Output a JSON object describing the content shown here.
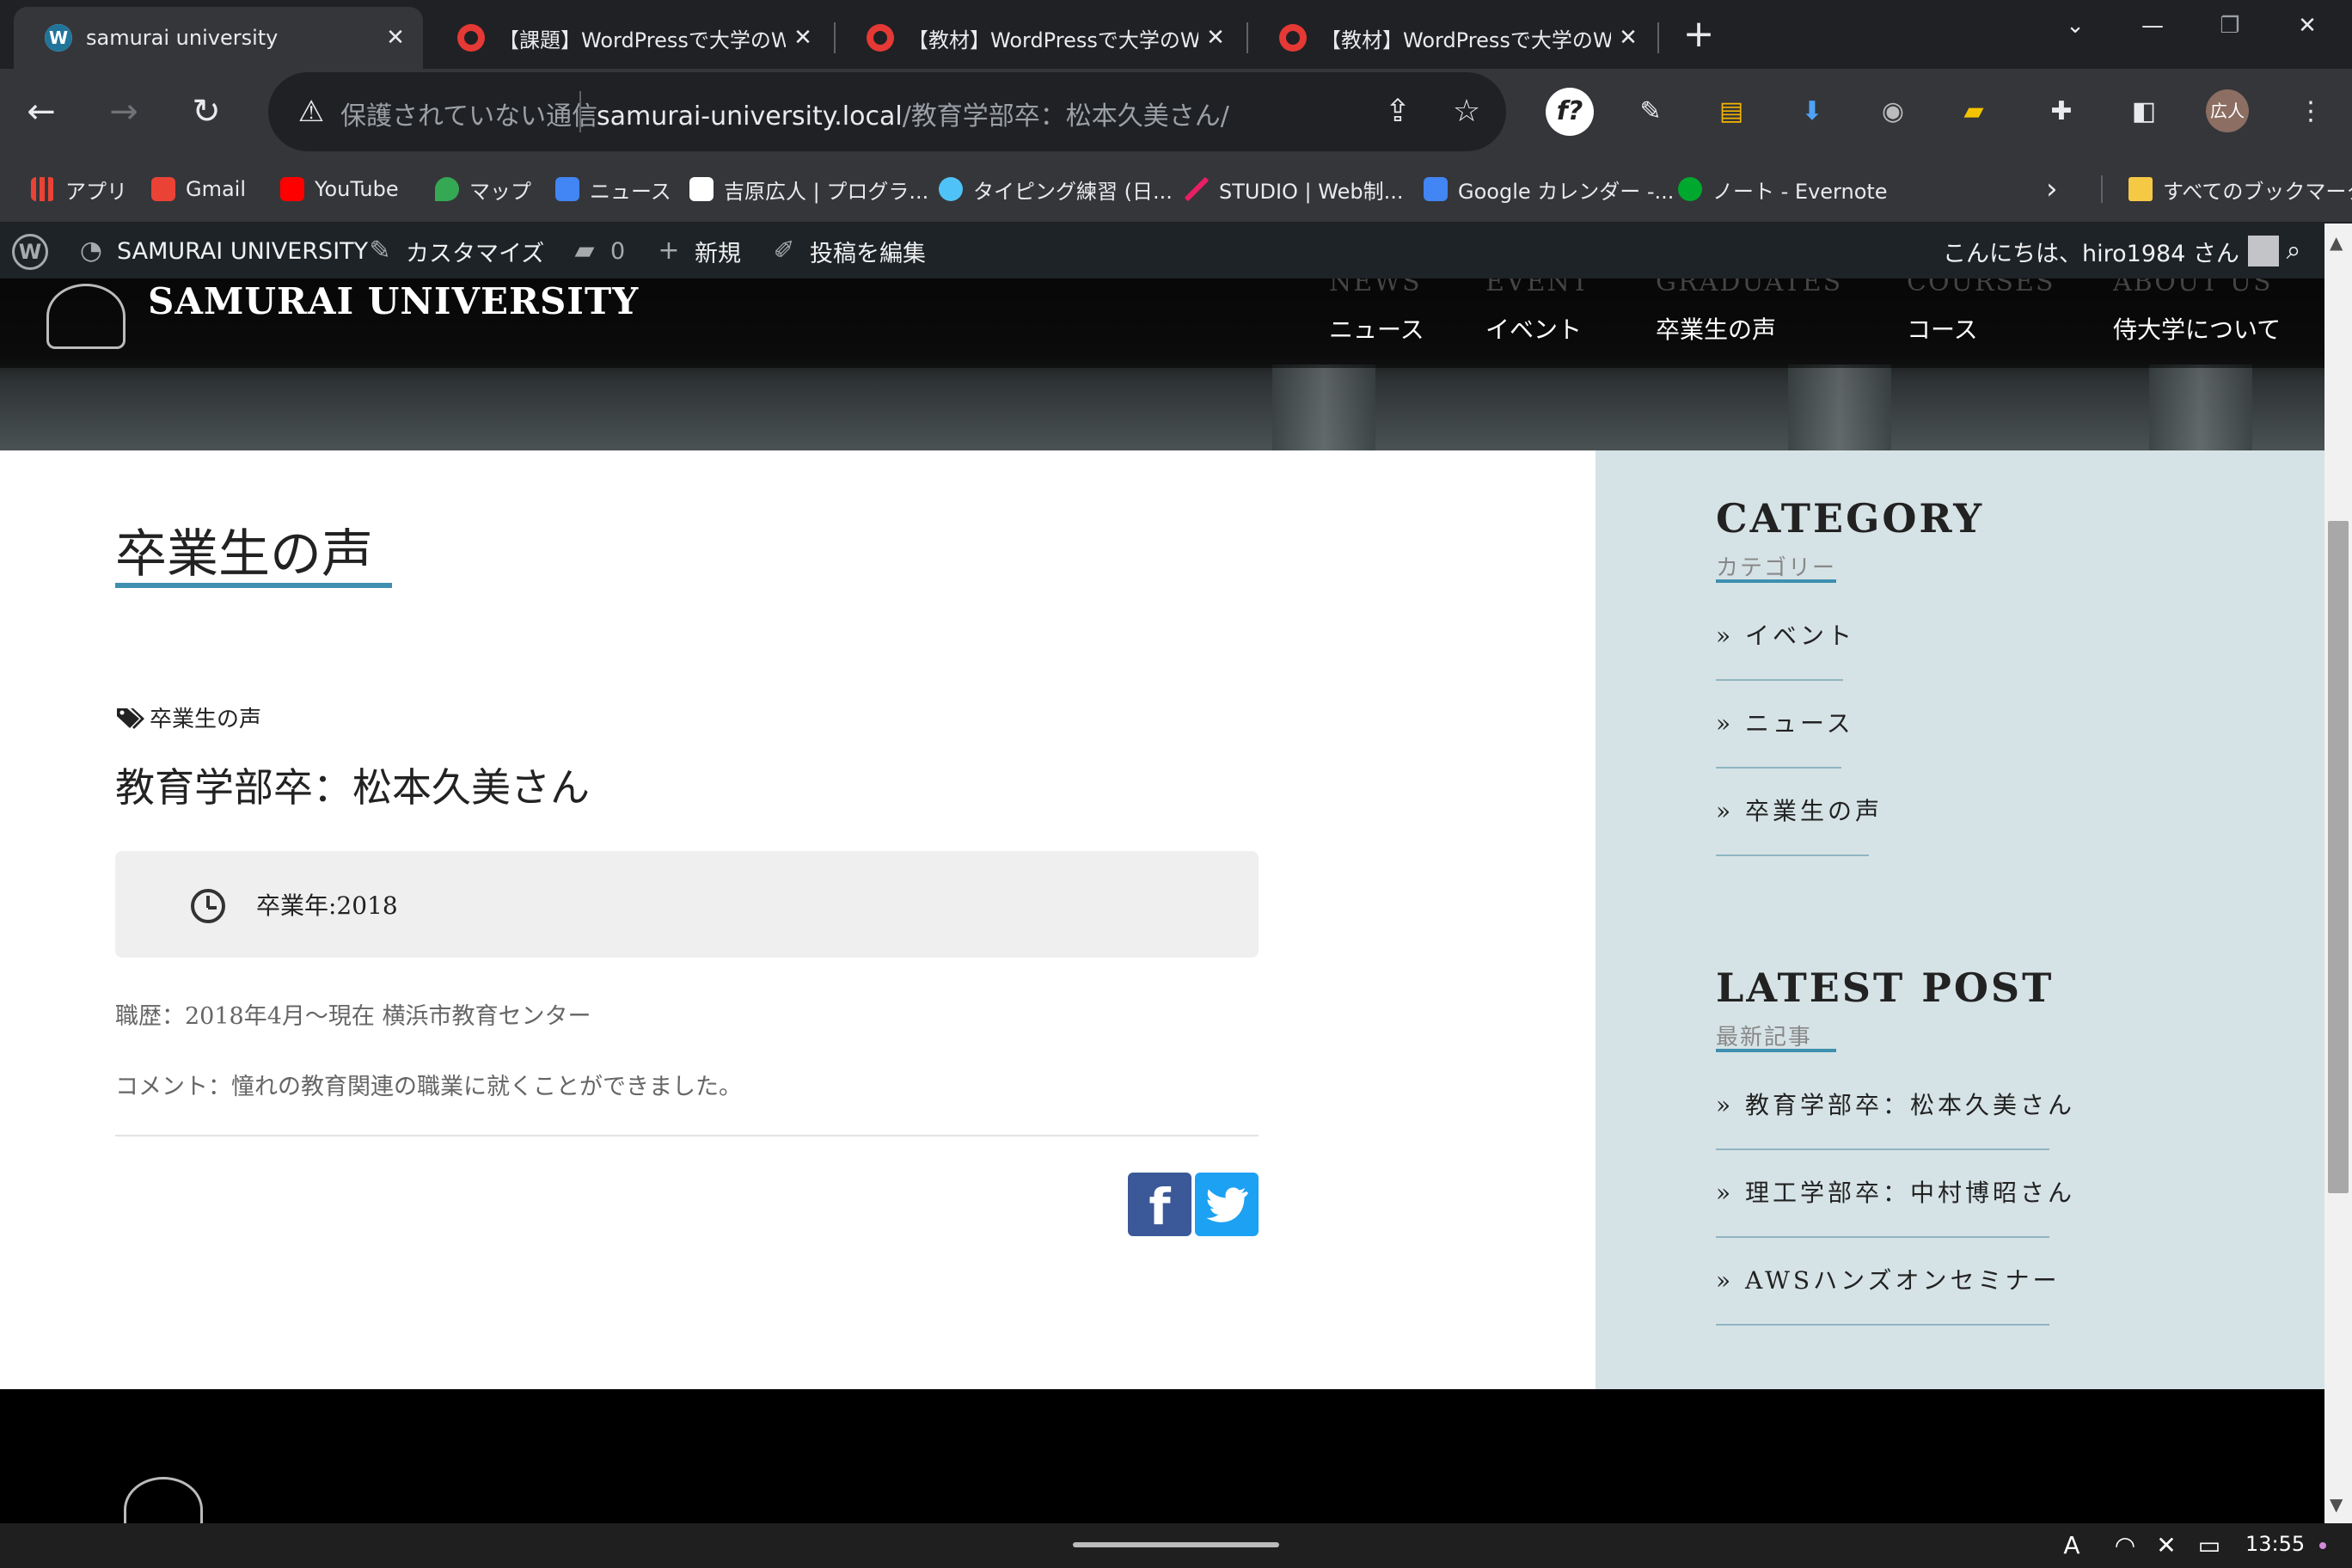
{
  "browser": {
    "tabs": [
      {
        "title": "samurai university",
        "favicon": "wordpress-icon",
        "active": true
      },
      {
        "title": "【課題】WordPressで大学のWe",
        "favicon": "samurai-icon",
        "active": false
      },
      {
        "title": "【教材】WordPressで大学のWe",
        "favicon": "samurai-icon",
        "active": false
      },
      {
        "title": "【教材】WordPressで大学のWe",
        "favicon": "samurai-icon",
        "active": false
      }
    ],
    "close_glyph": "✕",
    "new_tab_glyph": "+",
    "window_controls": {
      "chevron": "⌄",
      "minimize": "—",
      "restore": "❐",
      "close": "✕"
    },
    "omnibox": {
      "security_status": "保護されていない通信",
      "url_host": "samurai-university.local",
      "url_path": "/教育学部卒：松本久美さん/"
    },
    "bookmarks": [
      {
        "label": "アプリ",
        "color": "#ea4335"
      },
      {
        "label": "Gmail",
        "color": "#ea4335"
      },
      {
        "label": "YouTube",
        "color": "#ff0000"
      },
      {
        "label": "マップ",
        "color": "#34a853"
      },
      {
        "label": "ニュース",
        "color": "#4285f4"
      },
      {
        "label": "吉原広人 | プログラ...",
        "color": "#ffffff"
      },
      {
        "label": "タイピング練習 (日...",
        "color": "#4fc3f7"
      },
      {
        "label": "STUDIO | Web制...",
        "color": "#e91e63"
      },
      {
        "label": "Google カレンダー -...",
        "color": "#4285f4"
      },
      {
        "label": "ノート - Evernote",
        "color": "#00a82d"
      }
    ],
    "bookmarks_more": "›",
    "all_bookmarks": "すべてのブックマーク",
    "profile_initials": "広人"
  },
  "adminbar": {
    "site_name": "SAMURAI UNIVERSITY",
    "customize": "カスタマイズ",
    "comments_count": "0",
    "new": "新規",
    "edit_post": "投稿を編集",
    "greeting": "こんにちは、hiro1984 さん"
  },
  "site": {
    "title": "SAMURAI UNIVERSITY",
    "nav": [
      {
        "en": "NEWS",
        "ja": "ニュース"
      },
      {
        "en": "EVENT",
        "ja": "イベント"
      },
      {
        "en": "GRADUATES",
        "ja": "卒業生の声"
      },
      {
        "en": "COURSES",
        "ja": "コース"
      },
      {
        "en": "ABOUT US",
        "ja": "侍大学について"
      }
    ]
  },
  "post": {
    "page_title": "卒業生の声",
    "category": "卒業生の声",
    "title": "教育学部卒：松本久美さん",
    "graduation_year": "卒業年:2018",
    "career": "職歴：2018年4月〜現在 横浜市教育センター",
    "comment": "コメント：憧れの教育関連の職業に就くことができました。"
  },
  "sidebar": {
    "category_heading": "CATEGORY",
    "category_sub": "カテゴリー",
    "categories": [
      "» イベント",
      "» ニュース",
      "» 卒業生の声"
    ],
    "latest_heading": "LATEST POST",
    "latest_sub": "最新記事",
    "latest": [
      "» 教育学部卒：松本久美さん",
      "» 理工学部卒：中村博昭さん",
      "» AWSハンズオンセミナー"
    ]
  },
  "taskbar": {
    "time": "13:55"
  },
  "colors": {
    "accent": "#3f8fb0",
    "sidebar_bg": "#d6e3e6",
    "facebook": "#3b5998",
    "twitter": "#1da1f2"
  }
}
